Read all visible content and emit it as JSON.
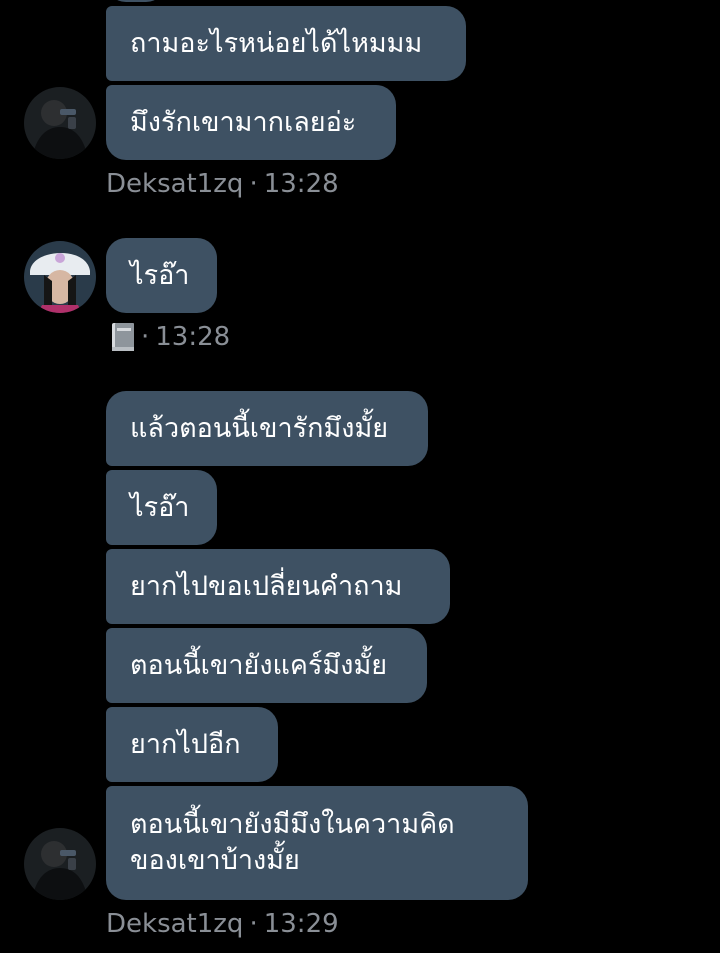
{
  "messages": [
    {
      "text": "ถามอะไรหน่อยได้ไหมมม"
    },
    {
      "text": "มึงรักเขามากเลยอ่ะ"
    },
    {
      "text": "ไรอ๊า"
    },
    {
      "text": "แล้วตอนนี้เขารักมึงมั้ย"
    },
    {
      "text": "ไรอ๊า"
    },
    {
      "text": "ยากไปขอเปลี่ยนคำถาม"
    },
    {
      "text": "ตอนนี้เขายังแคร์มึงมั้ย"
    },
    {
      "text": "ยากไปอีก"
    },
    {
      "lines": [
        "ตอนนี้เขายังมีมึงในความคิด",
        "ของเขาบ้างมั้ย"
      ]
    }
  ],
  "meta": [
    {
      "sender": "Deksat1zq",
      "separator": "·",
      "time": "13:28"
    },
    {
      "sender_icon": "book-icon",
      "separator": "·",
      "time": "13:28"
    },
    {
      "sender": "Deksat1zq",
      "separator": "·",
      "time": "13:29"
    }
  ],
  "colors": {
    "background": "#000000",
    "bubble": "#3e5163",
    "text": "#ffffff",
    "meta": "#8a8f96"
  }
}
